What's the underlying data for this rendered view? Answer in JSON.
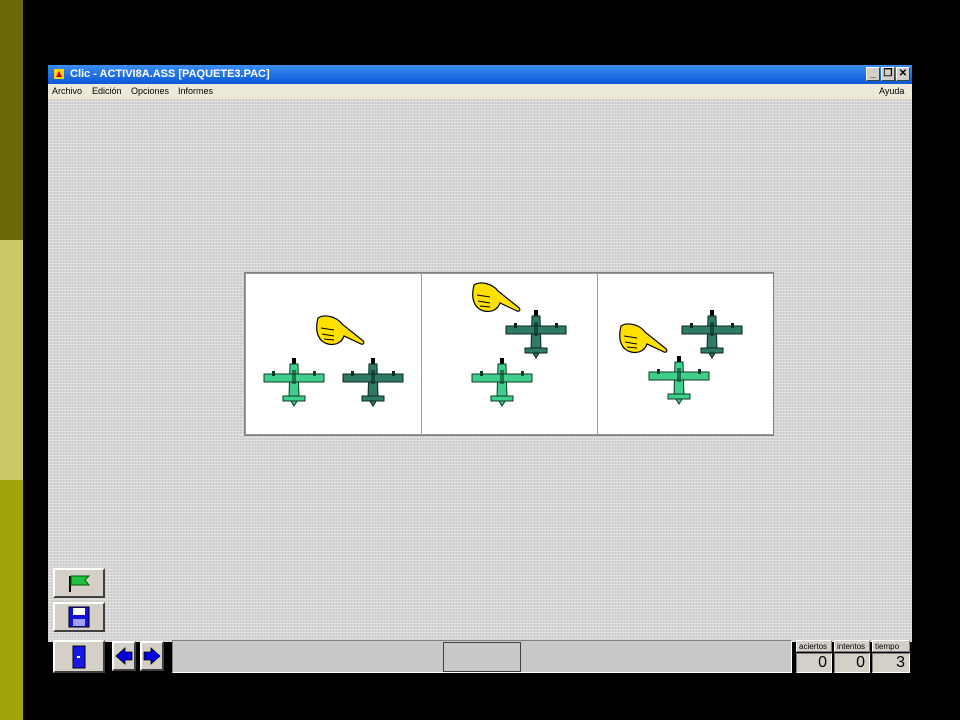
{
  "window": {
    "title": "Clic - ACTIVI8A.ASS [PAQUETE3.PAC]"
  },
  "menu": {
    "items": [
      "Archivo",
      "Edición",
      "Opciones",
      "Informes"
    ],
    "help": "Ayuda"
  },
  "window_controls": {
    "minimize": "_",
    "restore": "❐",
    "close": "✕"
  },
  "counters": {
    "aciertos": {
      "label": "aciertos",
      "value": "0"
    },
    "intentos": {
      "label": "intentos",
      "value": "0"
    },
    "tiempo": {
      "label": "tiempo",
      "value": "3"
    }
  },
  "icons": {
    "start": "green-flag-icon",
    "save": "floppy-disk-icon",
    "exit": "door-icon",
    "prev": "left-arrow-icon",
    "next": "right-arrow-icon",
    "pointer": "pointing-hand-icon",
    "plane": "airplane-icon"
  },
  "colors": {
    "titlebar": "#0a58d6",
    "plane_light": "#3fcf8c",
    "plane_dark": "#2f7a64",
    "hand": "#ffe000",
    "nav_arrow": "#0000e0",
    "side_dark": "#6a6a08",
    "side_light": "#c8c864",
    "side_mid": "#a3a30c"
  }
}
